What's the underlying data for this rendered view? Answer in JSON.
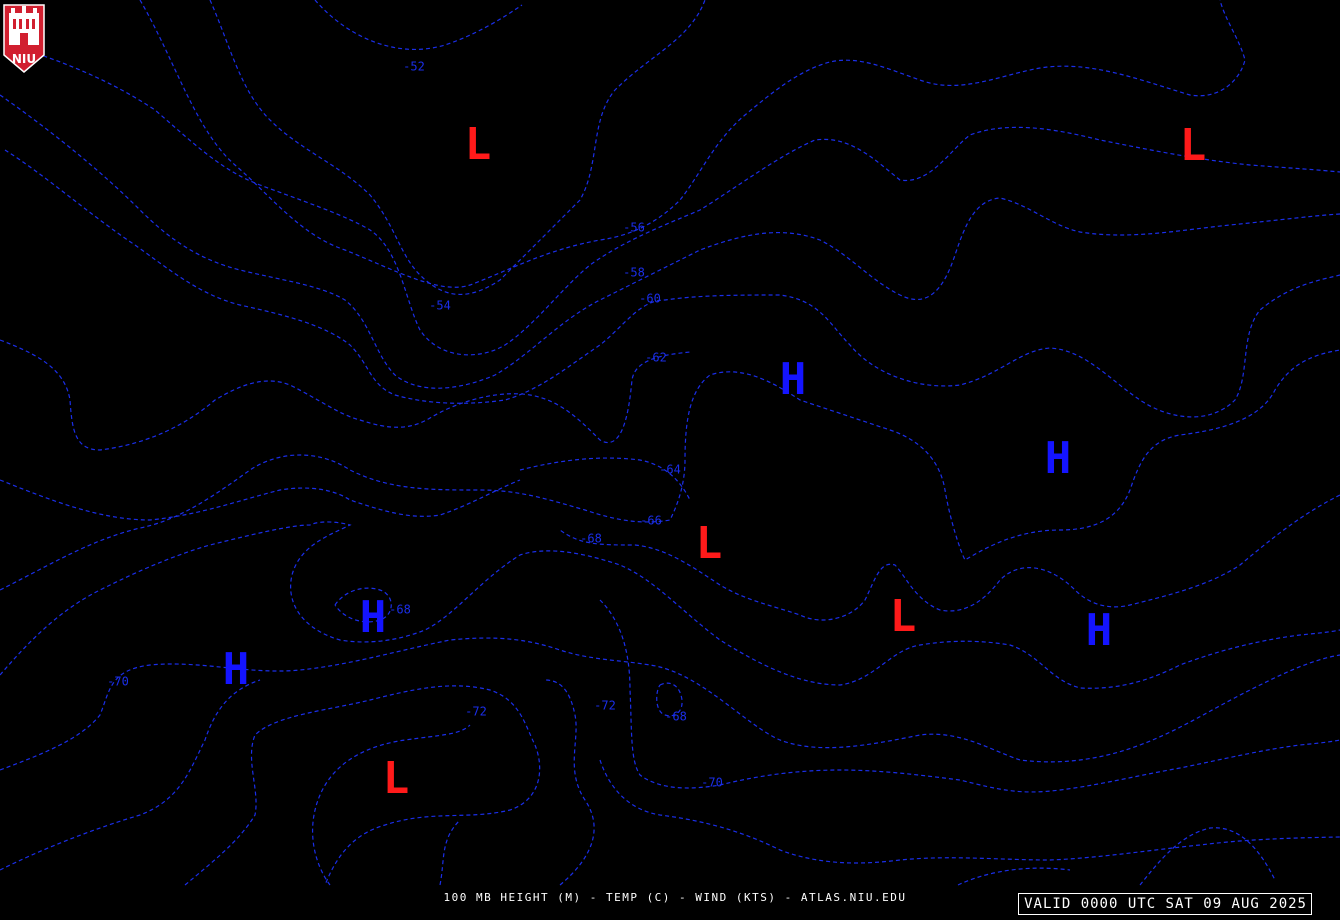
{
  "map": {
    "title": "100 MB HEIGHT (M) - TEMP (C) - WIND (KTS) - ATLAS.NIU.EDU",
    "valid_time": "VALID 0000 UTC SAT 09 AUG 2025",
    "logo_text": "NIU",
    "colors": {
      "background": "#000000",
      "isotherm": "#1a2ee8",
      "low_marker": "#ff1a1a",
      "high_marker": "#1414ff",
      "logo_red": "#d11f2f",
      "footer_text": "#ffffff"
    },
    "isotherm_labels": [
      "-52",
      "-56",
      "-58",
      "-60",
      "-62",
      "-64",
      "-54",
      "-66",
      "-68",
      "-68",
      "-70",
      "-72",
      "-72",
      "-68",
      "-70"
    ],
    "pressure_systems": [
      {
        "label": "L",
        "kind": "low"
      },
      {
        "label": "L",
        "kind": "low"
      },
      {
        "label": "H",
        "kind": "high"
      },
      {
        "label": "H",
        "kind": "high"
      },
      {
        "label": "L",
        "kind": "low"
      },
      {
        "label": "L",
        "kind": "low"
      },
      {
        "label": "H",
        "kind": "high"
      },
      {
        "label": "H",
        "kind": "high"
      },
      {
        "label": "H",
        "kind": "high"
      },
      {
        "label": "L",
        "kind": "low"
      }
    ]
  }
}
